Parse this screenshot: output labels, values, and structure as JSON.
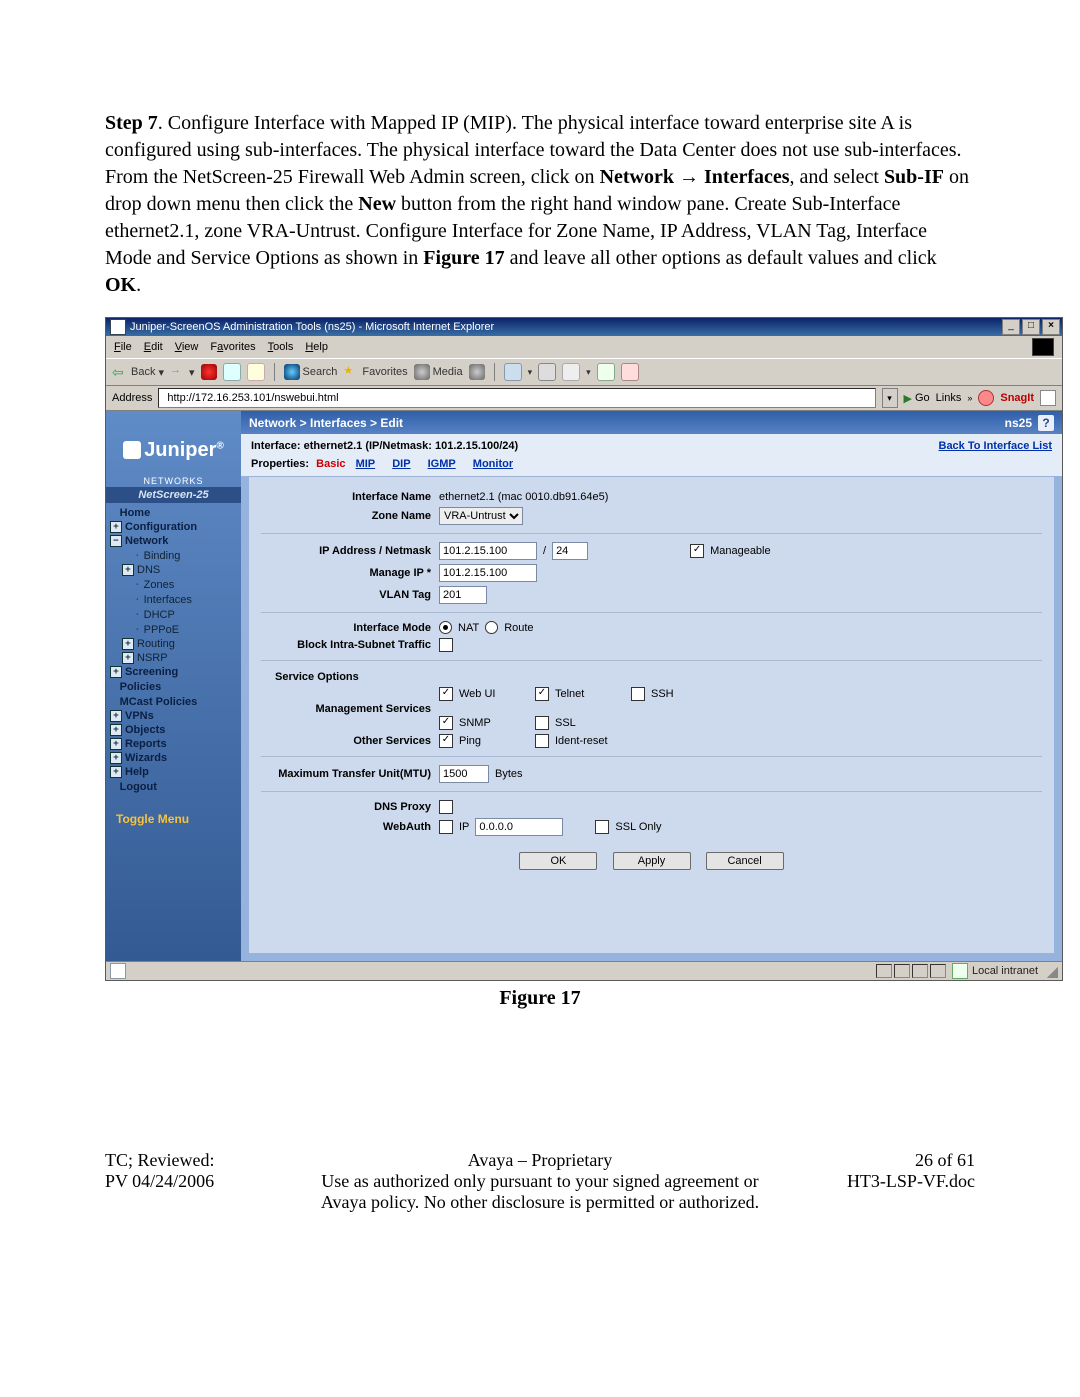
{
  "step_label": "Step 7",
  "instr": ". Configure Interface with Mapped IP (MIP). The physical interface toward enterprise site A is configured using sub-interfaces. The physical interface toward the Data Center does not use sub-interfaces. From the NetScreen-25 Firewall Web Admin screen, click on ",
  "instr_bold1": "Network",
  "instr_arrow": " → ",
  "instr_bold2": "Interfaces",
  "instr2": ", and select ",
  "instr_bold3": "Sub-IF",
  "instr3": " on drop down menu then click the ",
  "instr_bold4": "New",
  "instr4": " button from the right hand window pane. Create Sub-Interface ethernet2.1, zone VRA-Untrust. Configure Interface for Zone Name, IP Address, VLAN Tag, Interface Mode and Service Options as shown in ",
  "instr_bold5": "Figure 17",
  "instr5": " and leave all other options as default values and click ",
  "instr_bold6": "OK",
  "instr6": ".",
  "title": "Juniper-ScreenOS Administration Tools (ns25) - Microsoft Internet Explorer",
  "menu": {
    "file": "File",
    "edit": "Edit",
    "view": "View",
    "fav": "Favorites",
    "tools": "Tools",
    "help": "Help"
  },
  "tb": {
    "back": "Back",
    "search": "Search",
    "fav": "Favorites",
    "media": "Media"
  },
  "addr": {
    "label": "Address",
    "url": "http://172.16.253.101/nswebui.html",
    "go": "Go",
    "links": "Links",
    "snag": "SnagIt"
  },
  "logo": "Juniper",
  "logo_sub": "NETWORKS",
  "model": "NetScreen-25",
  "nav": {
    "home": "Home",
    "config": "Configuration",
    "network": "Network",
    "binding": "Binding",
    "dns": "DNS",
    "zones": "Zones",
    "interfaces": "Interfaces",
    "dhcp": "DHCP",
    "pppoe": "PPPoE",
    "routing": "Routing",
    "nsrp": "NSRP",
    "screening": "Screening",
    "policies": "Policies",
    "mcast": "MCast Policies",
    "vpns": "VPNs",
    "objects": "Objects",
    "reports": "Reports",
    "wizards": "Wizards",
    "help": "Help",
    "logout": "Logout",
    "toggle": "Toggle Menu"
  },
  "crumb": "Network > Interfaces > Edit",
  "device": "ns25",
  "sub_interface": "Interface: ethernet2.1 (IP/Netmask: 101.2.15.100/24)",
  "back_link": "Back To Interface List",
  "tabs": {
    "label": "Properties:",
    "basic": "Basic",
    "mip": "MIP",
    "dip": "DIP",
    "igmp": "IGMP",
    "monitor": "Monitor"
  },
  "f": {
    "ifname_lbl": "Interface Name",
    "ifname_val": "ethernet2.1 (mac 0010.db91.64e5)",
    "zone_lbl": "Zone Name",
    "zone_val": "VRA-Untrust",
    "ip_lbl": "IP Address / Netmask",
    "ip_val": "101.2.15.100",
    "mask_val": "24",
    "slash": "/",
    "manageable": "Manageable",
    "mip_lbl": "Manage IP *",
    "mip_val": "101.2.15.100",
    "vlan_lbl": "VLAN Tag",
    "vlan_val": "201",
    "mode_lbl": "Interface Mode",
    "nat": "NAT",
    "route": "Route",
    "block_lbl": "Block Intra-Subnet Traffic",
    "svc_hdr": "Service Options",
    "mgmt_lbl": "Management Services",
    "webui": "Web UI",
    "telnet": "Telnet",
    "ssh": "SSH",
    "snmp": "SNMP",
    "ssl": "SSL",
    "other_lbl": "Other Services",
    "ping": "Ping",
    "ident": "Ident-reset",
    "mtu_lbl": "Maximum Transfer Unit(MTU)",
    "mtu_val": "1500",
    "bytes": "Bytes",
    "dnsproxy": "DNS Proxy",
    "webauth": "WebAuth",
    "iplbl": "IP",
    "ipval": "0.0.0.0",
    "sslonly": "SSL Only",
    "ok": "OK",
    "apply": "Apply",
    "cancel": "Cancel"
  },
  "status_zone": "Local intranet",
  "figure": "Figure 17",
  "footer": {
    "l1": "TC; Reviewed:",
    "l2": "PV 04/24/2006",
    "c1": "Avaya – Proprietary",
    "c2": "Use as authorized only pursuant to your signed agreement or",
    "c3": "Avaya policy. No other disclosure is permitted or authorized.",
    "r1": "26 of 61",
    "r2": "HT3-LSP-VF.doc"
  }
}
